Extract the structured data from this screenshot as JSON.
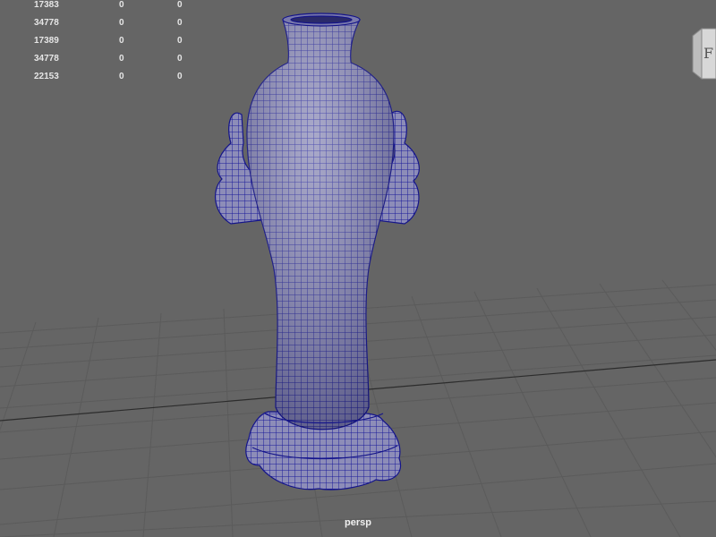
{
  "hud": {
    "rows": [
      {
        "value": "17383",
        "col2": "0",
        "col3": "0"
      },
      {
        "value": "34778",
        "col2": "0",
        "col3": "0"
      },
      {
        "value": "17389",
        "col2": "0",
        "col3": "0"
      },
      {
        "value": "34778",
        "col2": "0",
        "col3": "0"
      },
      {
        "value": "22153",
        "col2": "0",
        "col3": "0"
      }
    ]
  },
  "camera": {
    "label": "persp"
  },
  "viewcube": {
    "face_glyph": "F"
  },
  "colors": {
    "background": "#656565",
    "grid": "#5a5a5a",
    "wireframe": "#1e1ea0",
    "mesh_fill": "#8c8cb4"
  },
  "icons": [
    "viewcube-icon"
  ]
}
